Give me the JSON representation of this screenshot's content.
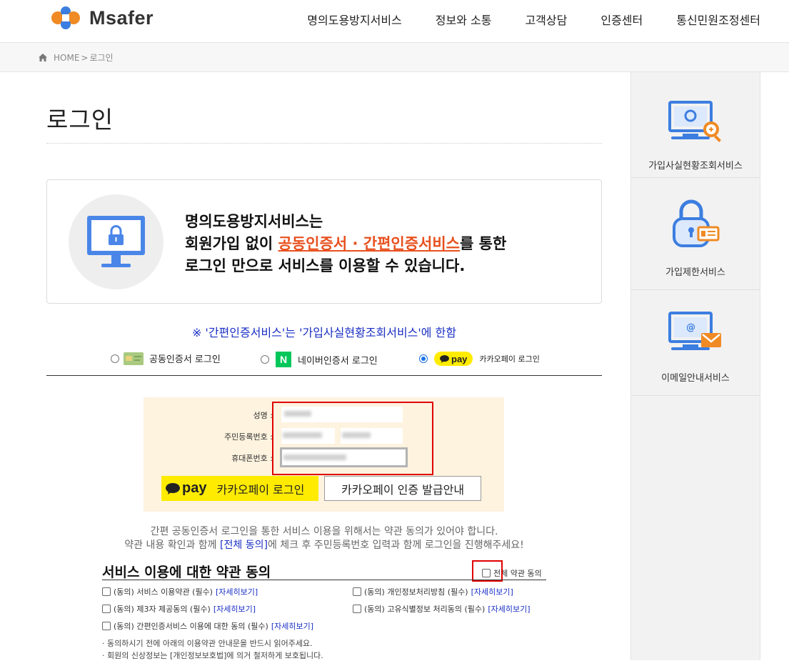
{
  "header": {
    "logo_text": "Msafer",
    "nav": [
      "명의도용방지서비스",
      "정보와 소통",
      "고객상담",
      "인증센터",
      "통신민원조정센터"
    ]
  },
  "breadcrumb": {
    "home": "HOME",
    "separator": ">",
    "current": "로그인"
  },
  "page_title": "로그인",
  "info": {
    "line1": "명의도용방지서비스는",
    "line2_prefix": "회원가입 없이 ",
    "line2_highlight": "공동인증서 · 간편인증서비스",
    "line2_suffix": "를 통한",
    "line3": "로그인 만으로 서비스를 이용할 수 있습니다."
  },
  "notice": "※ '간편인증서비스'는 '가입사실현황조회서비스'에 한함",
  "login_options": [
    {
      "label": "공동인증서 로그인",
      "selected": false,
      "icon": "certificate-icon"
    },
    {
      "label": "네이버인증서 로그인",
      "selected": false,
      "icon": "naver-icon",
      "badge": "N"
    },
    {
      "label": "카카오페이 로그인",
      "selected": true,
      "icon": "kakaopay-icon",
      "badge": "pay"
    }
  ],
  "form": {
    "name_label": "성명 :",
    "rrn_label": "주민등록번호 :",
    "phone_label": "휴대폰번호 :",
    "kakao_pay_mark": "pay",
    "kakao_login_button": "카카오페이 로그인",
    "issue_guide_button": "카카오페이 인증 발급안내"
  },
  "guide": {
    "line1": "간편 공동인증서 로그인을 통한 서비스 이용을 위해서는 약관 동의가 있어야 합니다.",
    "line2_prefix": "약관 내용 확인과 함께 ",
    "line2_link": "[전체 동의]",
    "line2_suffix": "에 체크 후 주민등록번호 입력과 함께 로그인을 진행해주세요!"
  },
  "terms": {
    "title": "서비스 이용에 대한 약관 동의",
    "all_agree": "전체 약관 동의",
    "detail_link": "[자세히보기]",
    "items": [
      "(동의) 서비스 이용약관 (필수)",
      "(동의) 개인정보처리방침 (필수)",
      "(동의) 제3자 제공동의 (필수)",
      "(동의) 고유식별정보 처리동의 (필수)",
      "(동의) 간편인증서비스 이용에 대한 동의 (필수)"
    ],
    "footnotes": [
      "· 동의하시기 전에 아래의 이용약관 안내문을 반드시 읽어주세요.",
      "· 회원의 신상정보는 [개인정보보호법]에 의거 철저하게 보호됩니다."
    ]
  },
  "sidebar": [
    {
      "label": "가입사실현황조회서비스",
      "icon": "monitor-search-icon"
    },
    {
      "label": "가입제한서비스",
      "icon": "lock-id-icon"
    },
    {
      "label": "이메일안내서비스",
      "icon": "monitor-email-icon"
    }
  ],
  "colors": {
    "accent_orange": "#e8501e",
    "link_blue": "#1a2fc4",
    "kakao_yellow": "#ffeb00",
    "naver_green": "#03c75a",
    "icon_blue": "#3c7ee0",
    "icon_orange": "#f08a24"
  }
}
